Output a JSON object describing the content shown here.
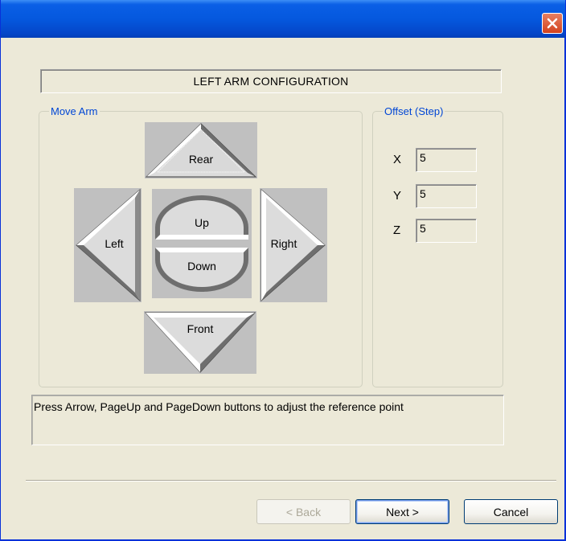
{
  "window": {
    "close_icon": "close-icon"
  },
  "header": {
    "title": "LEFT ARM CONFIGURATION"
  },
  "move_arm": {
    "group_label": "Move Arm",
    "buttons": {
      "rear": "Rear",
      "left": "Left",
      "up": "Up",
      "down": "Down",
      "right": "Right",
      "front": "Front"
    }
  },
  "offset": {
    "group_label": "Offset (Step)",
    "x_label": "X",
    "x_value": "5",
    "y_label": "Y",
    "y_value": "5",
    "z_label": "Z",
    "z_value": "5"
  },
  "message": {
    "text": "Press Arrow, PageUp and PageDown buttons to adjust the reference point"
  },
  "footer": {
    "back_label": "< Back",
    "next_label": "Next >",
    "cancel_label": "Cancel"
  },
  "colors": {
    "title_bar": "#0558de",
    "group_title": "#0046d5",
    "close_button": "#d3421e",
    "pad_background": "#c0c0c0"
  }
}
